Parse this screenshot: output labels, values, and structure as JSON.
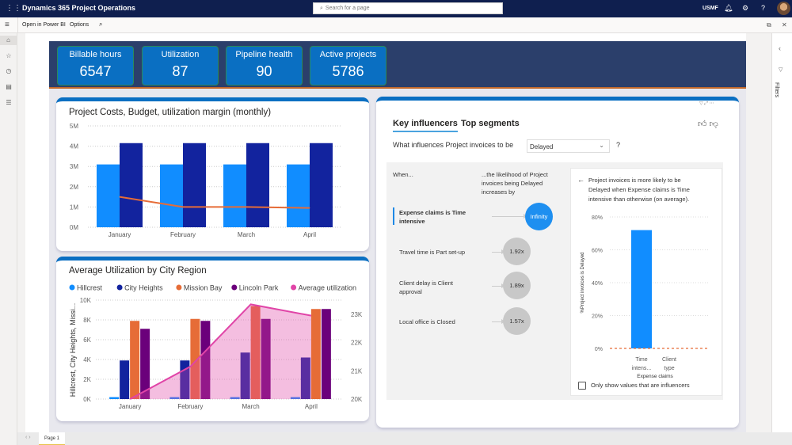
{
  "app": {
    "title": "Dynamics 365 Project Operations",
    "search_placeholder": "Search for a page",
    "company": "USMF",
    "icons": [
      "waffle-icon",
      "bell-icon",
      "gear-icon",
      "help-icon",
      "avatar"
    ]
  },
  "commandbar": {
    "open_power_bi": "Open in Power BI",
    "options": "Options"
  },
  "kpis": [
    {
      "label": "Billable hours",
      "value": "6547"
    },
    {
      "label": "Utilization",
      "value": "87"
    },
    {
      "label": "Pipeline health",
      "value": "90"
    },
    {
      "label": "Active projects",
      "value": "5786"
    }
  ],
  "filters_pane": {
    "label": "Filters"
  },
  "pagebar": {
    "page_tab": "Page 1"
  },
  "key_influencers": {
    "tab_active": "Key influencers",
    "tab_other": "Top segments",
    "question": "What influences Project invoices to be",
    "dropdown_value": "Delayed",
    "question_mark": "?",
    "col_when": "When...",
    "col_likelihood_1": "...the likelihood of Project",
    "col_likelihood_2": "invoices being Delayed",
    "col_likelihood_3": "increases by",
    "rows": [
      {
        "line1": "Expense claims is Time",
        "line2": "intensive",
        "value": "Infinity",
        "selected": true
      },
      {
        "line1": "Travel time is Part set-up",
        "line2": "",
        "value": "1.92x",
        "selected": false
      },
      {
        "line1": "Client delay is Client",
        "line2": "approval",
        "value": "1.89x",
        "selected": false
      },
      {
        "line1": "Local office is Closed",
        "line2": "",
        "value": "1.57x",
        "selected": false
      }
    ],
    "detail_line1": "Project invoices is more likely to be",
    "detail_line2": "Delayed when Expense claims is Time",
    "detail_line3": "intensive than otherwise (on average).",
    "checkbox_label": "Only show values that are influencers"
  },
  "chart_data": [
    {
      "type": "bar",
      "title": "Project Costs, Budget, utilization margin (monthly)",
      "categories": [
        "January",
        "February",
        "March",
        "April"
      ],
      "series": [
        {
          "name": "Costs",
          "kind": "bar",
          "color": "#118dff",
          "values": [
            3.1,
            3.1,
            3.1,
            3.1
          ]
        },
        {
          "name": "Budget",
          "kind": "bar",
          "color": "#12239e",
          "values": [
            4.15,
            4.15,
            4.15,
            4.15
          ]
        },
        {
          "name": "Utilization margin",
          "kind": "line",
          "color": "#e66c37",
          "values": [
            1.5,
            1.0,
            1.0,
            0.95
          ]
        }
      ],
      "yticks": [
        "0M",
        "1M",
        "2M",
        "3M",
        "4M",
        "5M"
      ],
      "ylim": [
        0,
        5
      ],
      "xlabel": "",
      "ylabel": "",
      "grid": true
    },
    {
      "type": "bar",
      "title": "Average Utilization by City Region",
      "categories": [
        "January",
        "February",
        "March",
        "April"
      ],
      "legend": [
        "Hillcrest",
        "City Heights",
        "Mission Bay",
        "Lincoln Park",
        "Average utilization"
      ],
      "legend_position": "top-left",
      "series": [
        {
          "name": "Hillcrest",
          "kind": "bar",
          "color": "#118dff",
          "values": [
            200,
            200,
            200,
            200
          ]
        },
        {
          "name": "City Heights",
          "kind": "bar",
          "color": "#12239e",
          "values": [
            3900,
            3900,
            4700,
            4200
          ]
        },
        {
          "name": "Mission Bay",
          "kind": "bar",
          "color": "#e66c37",
          "values": [
            7900,
            8100,
            9400,
            9100
          ]
        },
        {
          "name": "Lincoln Park",
          "kind": "bar",
          "color": "#6b007b",
          "values": [
            7100,
            7900,
            8100,
            9100
          ]
        },
        {
          "name": "Average utilization",
          "kind": "area",
          "axis": "right",
          "color": "#e044a7",
          "values": [
            20000,
            21150,
            23350,
            22950
          ]
        }
      ],
      "yticks": [
        "0K",
        "2K",
        "4K",
        "6K",
        "8K",
        "10K"
      ],
      "ylim": [
        0,
        10000
      ],
      "y2ticks": [
        "20K",
        "21K",
        "22K",
        "23K"
      ],
      "y2lim": [
        20000,
        23500
      ],
      "ylabel": "Hillcrest, City Heights, Missi...",
      "grid": true
    },
    {
      "type": "bar",
      "title": "",
      "categories": [
        "Time intens...",
        "Client type"
      ],
      "values": [
        72,
        0
      ],
      "color": "#118dff",
      "yticks": [
        "0%",
        "20%",
        "40%",
        "60%",
        "80%"
      ],
      "ylim": [
        0,
        80
      ],
      "ylabel": "%Project invoices is Delayed",
      "xlabel": "Expense claims",
      "reference_line": 0
    }
  ]
}
